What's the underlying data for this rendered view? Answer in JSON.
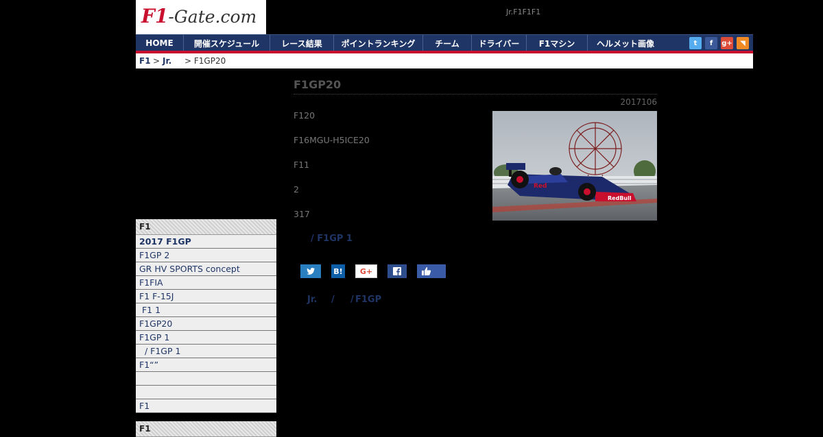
{
  "header": {
    "logo": {
      "part1": "F1",
      "part2": "-Gate.com"
    },
    "tagline": "Jr.F1F1F1"
  },
  "nav": {
    "items": [
      {
        "label": "HOME"
      },
      {
        "label": "開催スケジュール"
      },
      {
        "label": "レース結果"
      },
      {
        "label": "ポイントランキング"
      },
      {
        "label": "チーム"
      },
      {
        "label": "ドライバー"
      },
      {
        "label": "F1マシン"
      },
      {
        "label": "ヘルメット画像"
      }
    ],
    "social": [
      {
        "name": "twitter-icon",
        "glyph": "t",
        "color": "#55acee"
      },
      {
        "name": "facebook-icon",
        "glyph": "f",
        "color": "#3b5998"
      },
      {
        "name": "google-plus-icon",
        "glyph": "g+",
        "color": "#dd4b39"
      },
      {
        "name": "rss-icon",
        "glyph": "◥",
        "color": "#f08a24"
      }
    ]
  },
  "breadcrumb": {
    "home": "F1",
    "sep": ">",
    "category": "Jr.",
    "current": "> F1GP20"
  },
  "article": {
    "title": "F1GP20",
    "date": "2017106",
    "paragraphs": [
      "F120",
      "F16MGU-H5ICE20",
      "F11",
      "2",
      "317"
    ],
    "related": "/ F1GP 1",
    "share": {
      "hatena": "B!",
      "gplus": "G+"
    },
    "tags": {
      "t1": "Jr.",
      "sep1": "/",
      "sep2": "/",
      "t2": "F1GP"
    }
  },
  "sidebar": {
    "heading": "F1",
    "items": [
      {
        "label": "2017 F1GP"
      },
      {
        "label": "F1GP 2"
      },
      {
        "label": "GR HV SPORTS concept"
      },
      {
        "label": "F1FIA"
      },
      {
        "label": "F1 F-15J"
      },
      {
        "label": " F1 1"
      },
      {
        "label": "F1GP20"
      },
      {
        "label": "F1GP 1"
      },
      {
        "label": "  / F1GP 1"
      },
      {
        "label": "F1“”"
      },
      {
        "label": ""
      },
      {
        "label": ""
      },
      {
        "label": "F1"
      }
    ],
    "heading2": "F1"
  }
}
